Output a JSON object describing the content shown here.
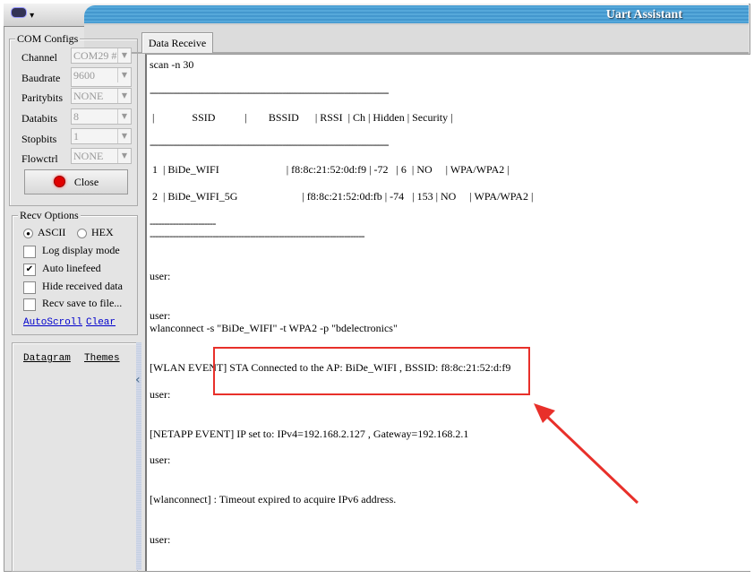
{
  "window": {
    "title": "Uart Assistant",
    "menu_icon": "app-logo-icon"
  },
  "com_configs": {
    "title": "COM Configs",
    "fields": [
      {
        "label": "Channel",
        "value": "COM29 #"
      },
      {
        "label": "Baudrate",
        "value": "9600"
      },
      {
        "label": "Paritybits",
        "value": "NONE"
      },
      {
        "label": "Databits",
        "value": "8"
      },
      {
        "label": "Stopbits",
        "value": "1"
      },
      {
        "label": "Flowctrl",
        "value": "NONE"
      }
    ],
    "close_button": "Close",
    "status_color": "#e00000"
  },
  "recv_options": {
    "title": "Recv Options",
    "ascii": "ASCII",
    "hex": "HEX",
    "format_selected": "ASCII",
    "options": [
      {
        "label": "Log display mode",
        "checked": false
      },
      {
        "label": "Auto linefeed",
        "checked": true
      },
      {
        "label": "Hide received data",
        "checked": false
      },
      {
        "label": "Recv save to file...",
        "checked": false
      }
    ],
    "autoscroll": "AutoScroll",
    "clear": "Clear"
  },
  "bottom_panel": {
    "datagram": "Datagram",
    "themes": "Themes"
  },
  "tab": {
    "label": "Data Receive"
  },
  "terminal": {
    "lines": [
      "scan -n 30",
      "--------------------------------------------------------------------------------------------",
      " |              SSID           |        BSSID      | RSSI  | Ch | Hidden | Security |",
      "--------------------------------------------------------------------------------------------",
      " 1  | BiDe_WIFI                         | f8:8c:21:52:0d:f9 | -72   | 6  | NO     | WPA/WPA2 |",
      " 2  | BiDe_WIFI_5G                        | f8:8c:21:52:0d:fb | -74   | 153 | NO     | WPA/WPA2 |",
      "-----------------------",
      "---------------------------------------------------------------------------",
      "user:",
      "user:",
      "wlanconnect -s \"BiDe_WIFI\" -t WPA2 -p \"bdelectronics\"",
      "[WLAN EVENT] STA Connected to the AP: BiDe_WIFI , BSSID: f8:8c:21:52:d:f9",
      "user:",
      "[NETAPP EVENT] IP set to: IPv4=192.168.2.127 , Gateway=192.168.2.1",
      "user:",
      "[wlanconnect] : Timeout expired to acquire IPv6 address.",
      "user:"
    ]
  },
  "annotation": {
    "color": "#e8302a"
  }
}
